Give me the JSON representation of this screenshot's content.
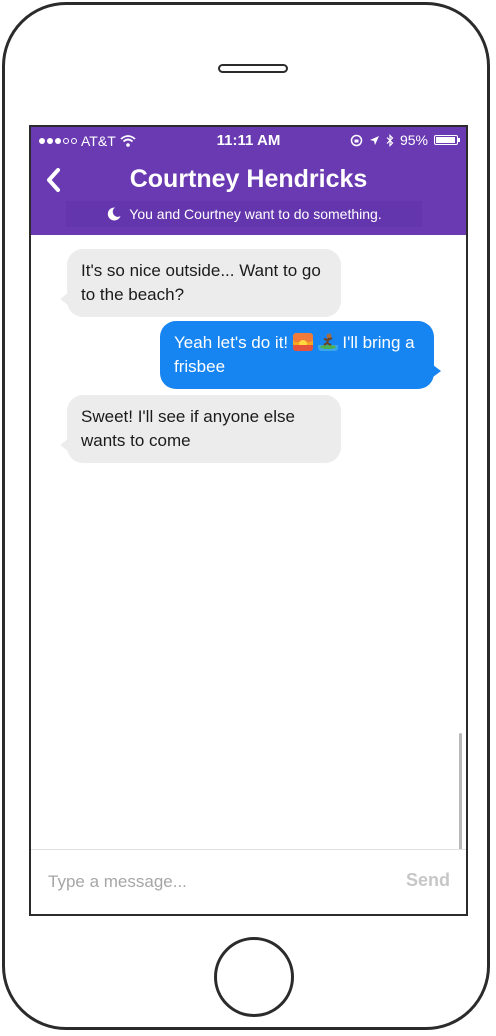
{
  "status_bar": {
    "carrier": "AT&T",
    "time": "11:11 AM",
    "battery": "95%",
    "icons": [
      "signal-dots-icon",
      "wifi-icon",
      "rotation-lock-icon",
      "location-icon",
      "bluetooth-icon",
      "battery-icon"
    ]
  },
  "header": {
    "title": "Courtney Hendricks",
    "subtitle": "You and Courtney want to do something.",
    "back_icon": "chevron-left-icon",
    "subtitle_icon": "moon-icon",
    "color": "#6a3ab2"
  },
  "messages": [
    {
      "direction": "incoming",
      "text": "It's so nice outside... Want to go to the beach?"
    },
    {
      "direction": "outgoing",
      "text_before": "Yeah let's do it!",
      "emojis": [
        "sunrise-emoji",
        "surfer-emoji"
      ],
      "text_after": "I'll bring a frisbee"
    },
    {
      "direction": "incoming",
      "text": "Sweet! I'll see if anyone else wants to come"
    }
  ],
  "composer": {
    "placeholder": "Type a message...",
    "send_label": "Send"
  },
  "colors": {
    "incoming_bubble": "#ececec",
    "outgoing_bubble": "#1684f1"
  }
}
